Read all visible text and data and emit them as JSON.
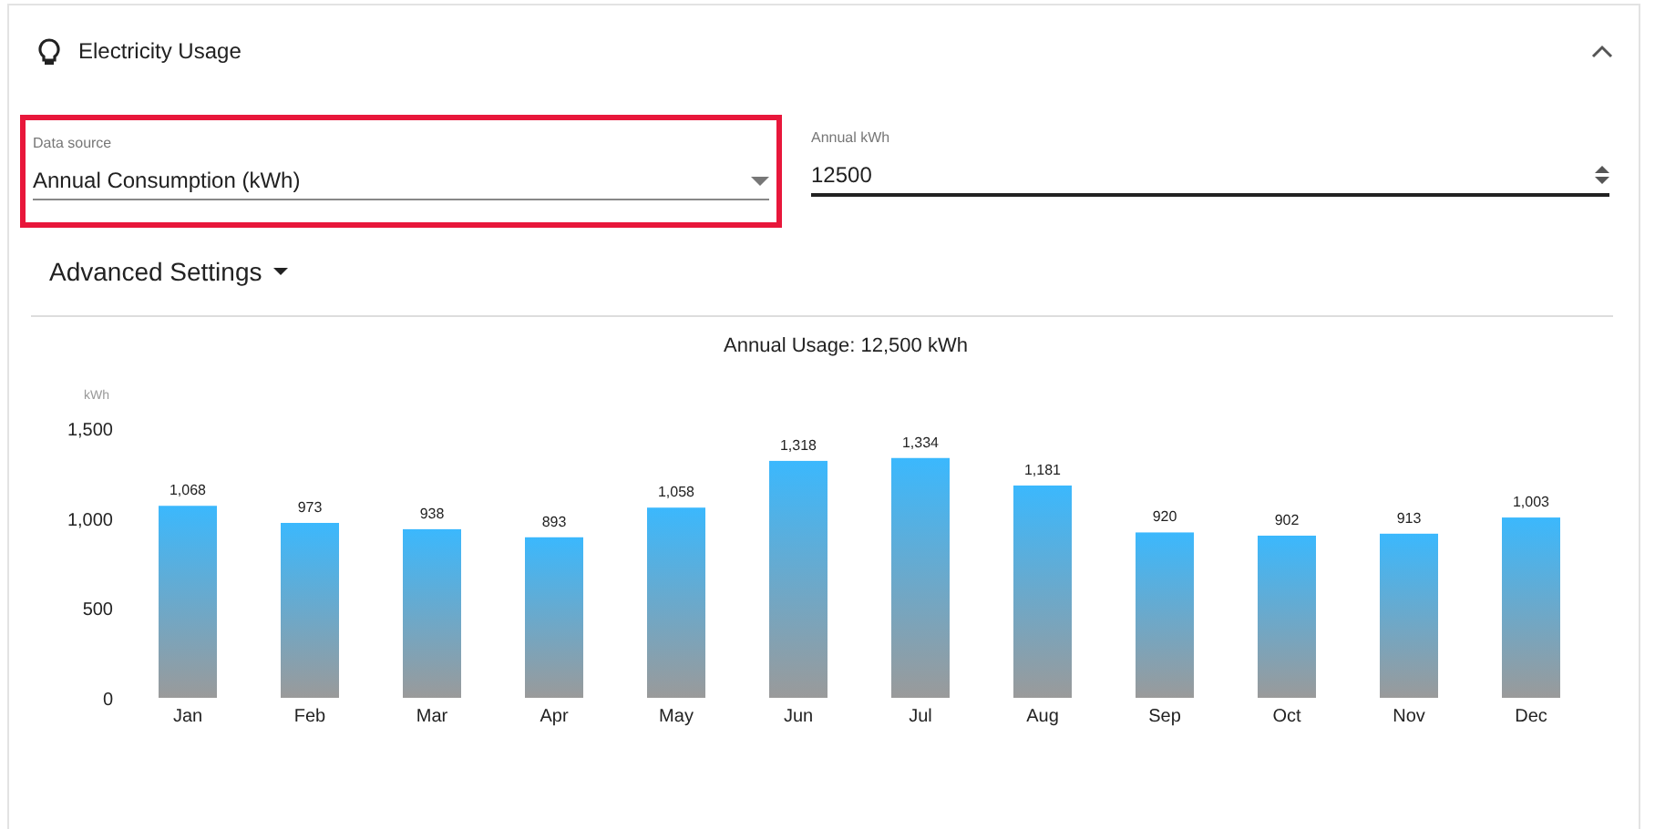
{
  "panel": {
    "title": "Electricity Usage",
    "expanded": true
  },
  "data_source": {
    "label": "Data source",
    "value": "Annual Consumption (kWh)",
    "highlighted": true
  },
  "annual_kwh": {
    "label": "Annual kWh",
    "value": "12500"
  },
  "advanced_settings": {
    "label": "Advanced Settings",
    "expanded": false
  },
  "chart_data": {
    "type": "bar",
    "title": "Annual Usage: 12,500 kWh",
    "ylabel": "kWh",
    "categories": [
      "Jan",
      "Feb",
      "Mar",
      "Apr",
      "May",
      "Jun",
      "Jul",
      "Aug",
      "Sep",
      "Oct",
      "Nov",
      "Dec"
    ],
    "series": [
      {
        "color": "#3bb8fd",
        "values": [
          1068,
          973,
          938,
          893,
          1058,
          1318,
          1334,
          1181,
          920,
          902,
          913,
          1003
        ]
      }
    ],
    "ylim": [
      0,
      1500
    ],
    "yticks": [
      {
        "value": 0,
        "label": "0"
      },
      {
        "value": 500,
        "label": "500"
      },
      {
        "value": 1000,
        "label": "1,000"
      },
      {
        "value": 1500,
        "label": "1,500"
      }
    ],
    "value_labels": [
      "1,068",
      "973",
      "938",
      "893",
      "1,058",
      "1,318",
      "1,334",
      "1,181",
      "920",
      "902",
      "913",
      "1,003"
    ]
  }
}
